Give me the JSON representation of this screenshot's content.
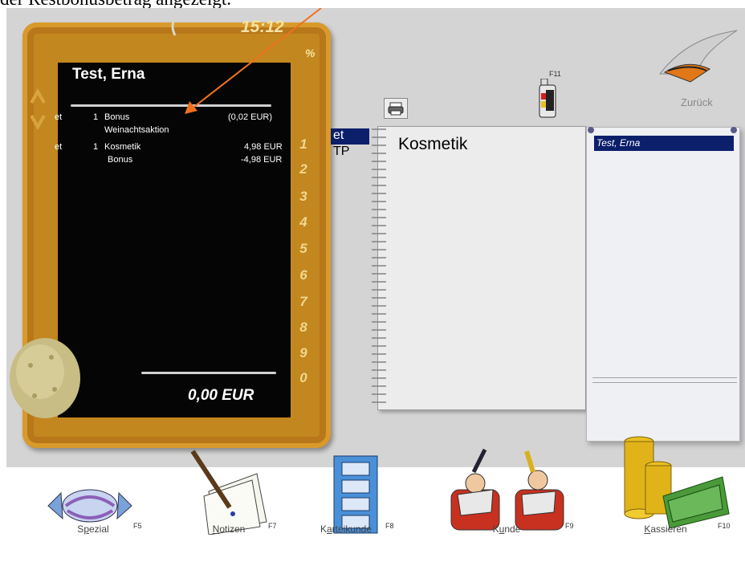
{
  "caption": {
    "text": "der Restbonusbetrag angezeigt."
  },
  "slate": {
    "time": "15:12",
    "percent": "%",
    "customer": "Test, Erna",
    "lines": [
      {
        "col": "et",
        "qty": "1",
        "name": "Bonus",
        "amount": "(0,02 EUR)",
        "sub": "Weinachtsaktion"
      },
      {
        "col": "et",
        "qty": "1",
        "name": "Kosmetik",
        "amount": "4,98 EUR",
        "sub": "Bonus",
        "sub_amount": "-4,98 EUR"
      }
    ],
    "digits": [
      "1",
      "2",
      "3",
      "4",
      "5",
      "6",
      "7",
      "8",
      "9",
      "0"
    ],
    "total": "0,00 EUR"
  },
  "categories": {
    "items": [
      "et",
      "TP"
    ],
    "selected": "et"
  },
  "notebook": {
    "title": "Kosmetik"
  },
  "customer_list": {
    "items": [
      "Test, Erna"
    ]
  },
  "toolbar": {
    "back_label": "Zurück",
    "f11": "F11",
    "buttons": [
      {
        "label_pre": "S",
        "label_u": "p",
        "label_post": "ezial",
        "key": "F5"
      },
      {
        "label_pre": "",
        "label_u": "N",
        "label_post": "otizen",
        "key": "F7"
      },
      {
        "label_pre": "K",
        "label_u": "a",
        "label_post": "rteikunde",
        "key": "F8"
      },
      {
        "label_pre": "K",
        "label_u": "u",
        "label_post": "nde",
        "key": "F9"
      },
      {
        "label_pre": "",
        "label_u": "K",
        "label_post": "assieren",
        "key": "F10"
      }
    ]
  },
  "colors": {
    "accent": "#f07020",
    "selection": "#0b1f6b",
    "frame": "#c2871f"
  }
}
